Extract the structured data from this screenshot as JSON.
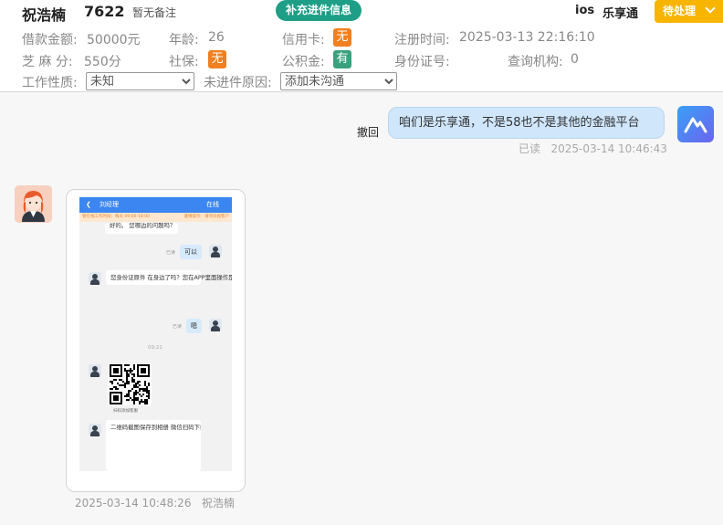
{
  "header": {
    "name": "祝浩楠",
    "user_id": "7622",
    "note": "暂无备注",
    "supplement_button": "补充进件信息",
    "platform": "ios",
    "brand": "乐享通",
    "pending_button": "待处理"
  },
  "info": {
    "loan_amount_label": "借款金额:",
    "loan_amount_value": "50000元",
    "age_label": "年龄:",
    "age_value": "26",
    "credit_card_label": "信用卡:",
    "credit_card_value": "无",
    "register_time_label": "注册时间:",
    "register_time_value": "2025-03-13 22:16:10",
    "sesame_label": "芝 麻 分:",
    "sesame_value": "550分",
    "social_security_label": "社保:",
    "social_security_value": "无",
    "housing_fund_label": "公积金:",
    "housing_fund_value": "有",
    "id_number_label": "身份证号:",
    "query_org_label": "查询机构:",
    "query_org_value": "0",
    "job_label": "工作性质:",
    "job_value": "未知",
    "reason_label": "未进件原因:",
    "reason_value": "添加未沟通"
  },
  "chat": {
    "withdraw_label": "撤回",
    "outgoing_text": "咱们是乐享通，不是58也不是其他的金融平台",
    "outgoing_status": "已读",
    "outgoing_time": "2025-03-14 10:46:43",
    "incoming_time": "2025-03-14 10:48:26",
    "incoming_sender": "祝浩楠"
  },
  "screenshot": {
    "title": "刘经理",
    "status": "在线",
    "warning_left": "管在线工作时间：每天 09:00-18:00",
    "warning_right": "谨慎提示：请勿乐视客户",
    "msg1_text": "好的。 您哪边的问题吗？",
    "read1": "已读",
    "reply1": "可以",
    "msg2_text": "您身份证原件 在身边了吗？您在APP里面操作是需要扫描身份证原件的",
    "read2": "已读",
    "reply2": "嗯",
    "time_mark": "09:21",
    "qr_caption": "扫码添加客服",
    "msg3_text": "二维码截图保存到相册 微信扫码下载APP 下载好用绑定银行卡的手机号登录上去 登录好首页截图我 不要乱点"
  },
  "colors": {
    "accent_green": "#1e9e86",
    "pending_orange": "#f7b500",
    "badge_orange": "#f08020",
    "badge_green": "#3aa17e",
    "bubble_blue": "#cfe6fb"
  }
}
